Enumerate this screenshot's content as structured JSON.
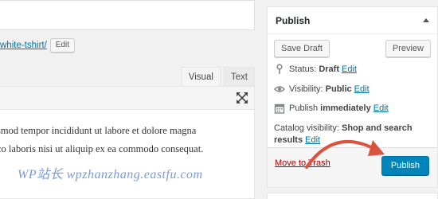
{
  "permalink": {
    "slug": "white-tshirt/",
    "edit_label": "Edit"
  },
  "editor": {
    "tabs": [
      "Visual",
      "Text"
    ],
    "content_lines": [
      "smod tempor incididunt ut labore et dolore magna",
      "co laboris nisi ut aliquip ex ea commodo consequat."
    ]
  },
  "publish": {
    "title": "Publish",
    "save_draft_label": "Save Draft",
    "preview_label": "Preview",
    "status_label": "Status:",
    "status_value": "Draft",
    "visibility_label": "Visibility:",
    "visibility_value": "Public",
    "schedule_prefix": "Publish",
    "schedule_value": "immediately",
    "catalog_label": "Catalog visibility:",
    "catalog_value": "Shop and search results",
    "edit_link": "Edit",
    "trash_label": "Move to Trash",
    "publish_label": "Publish"
  },
  "watermark": "WP站长 wpzhanzhang.eastfu.com",
  "colors": {
    "link": "#0073aa",
    "primary_button": "#0085ba",
    "trash": "#a00000",
    "arrow": "#d9533f"
  }
}
